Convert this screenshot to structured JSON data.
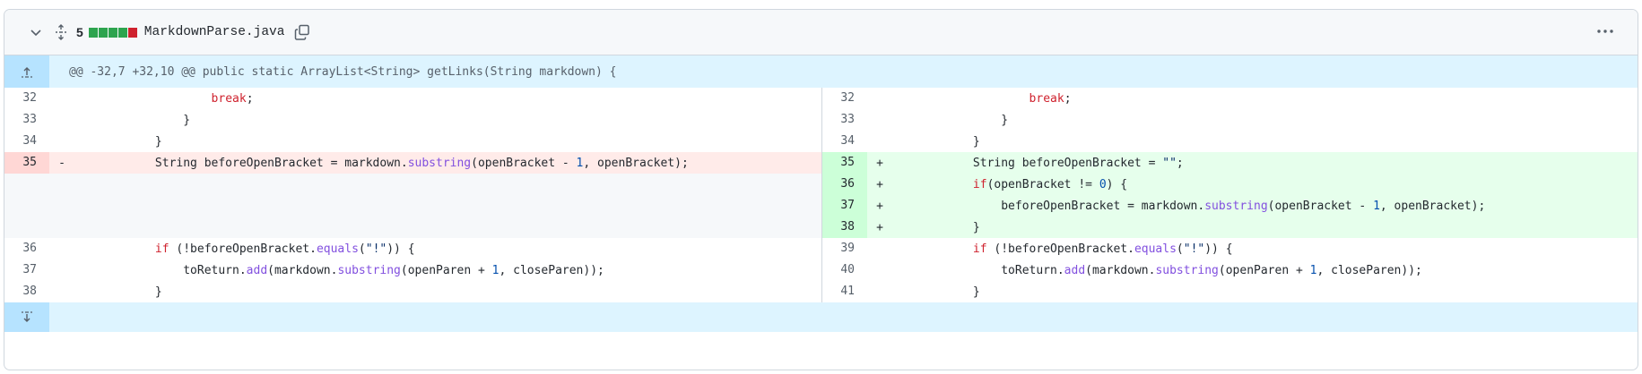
{
  "file_header": {
    "change_count": "5",
    "file_name": "MarkdownParse.java",
    "diffstat": [
      "#2da44e",
      "#2da44e",
      "#2da44e",
      "#2da44e",
      "#cf222e"
    ],
    "icons": {
      "collapse": "chevron-down-icon",
      "expand_all": "unfold-icon",
      "copy": "copy-icon",
      "more": "kebab-horizontal-icon"
    }
  },
  "hunk_header": {
    "text": "@@ -32,7 +32,10 @@ public static ArrayList<String> getLinks(String markdown) {",
    "expand_up_icon": "fold-up-icon"
  },
  "left_lines": [
    {
      "num": "32",
      "type": "context",
      "marker": "",
      "tokens": [
        [
          "",
          "                    "
        ],
        [
          "kw",
          "break"
        ],
        [
          "",
          ";"
        ]
      ]
    },
    {
      "num": "33",
      "type": "context",
      "marker": "",
      "tokens": [
        [
          "",
          "                }"
        ]
      ]
    },
    {
      "num": "34",
      "type": "context",
      "marker": "",
      "tokens": [
        [
          "",
          "            }"
        ]
      ]
    },
    {
      "num": "35",
      "type": "del",
      "marker": "-",
      "tokens": [
        [
          "",
          "            String beforeOpenBracket = markdown."
        ],
        [
          "fn",
          "substring"
        ],
        [
          "",
          "(openBracket - "
        ],
        [
          "num",
          "1"
        ],
        [
          "",
          ", openBracket);"
        ]
      ]
    },
    {
      "num": "",
      "type": "empty",
      "marker": "",
      "tokens": []
    },
    {
      "num": "",
      "type": "empty",
      "marker": "",
      "tokens": []
    },
    {
      "num": "",
      "type": "empty",
      "marker": "",
      "tokens": []
    },
    {
      "num": "36",
      "type": "context",
      "marker": "",
      "tokens": [
        [
          "",
          "            "
        ],
        [
          "kw",
          "if"
        ],
        [
          "",
          " (!beforeOpenBracket."
        ],
        [
          "fn",
          "equals"
        ],
        [
          "",
          "("
        ],
        [
          "str",
          "\"!\""
        ],
        [
          "",
          ")) {"
        ]
      ]
    },
    {
      "num": "37",
      "type": "context",
      "marker": "",
      "tokens": [
        [
          "",
          "                toReturn."
        ],
        [
          "fn",
          "add"
        ],
        [
          "",
          "(markdown."
        ],
        [
          "fn",
          "substring"
        ],
        [
          "",
          "(openParen + "
        ],
        [
          "num",
          "1"
        ],
        [
          "",
          ", closeParen));"
        ]
      ]
    },
    {
      "num": "38",
      "type": "context",
      "marker": "",
      "tokens": [
        [
          "",
          "            }"
        ]
      ]
    }
  ],
  "right_lines": [
    {
      "num": "32",
      "type": "context",
      "marker": "",
      "tokens": [
        [
          "",
          "                    "
        ],
        [
          "kw",
          "break"
        ],
        [
          "",
          ";"
        ]
      ]
    },
    {
      "num": "33",
      "type": "context",
      "marker": "",
      "tokens": [
        [
          "",
          "                }"
        ]
      ]
    },
    {
      "num": "34",
      "type": "context",
      "marker": "",
      "tokens": [
        [
          "",
          "            }"
        ]
      ]
    },
    {
      "num": "35",
      "type": "add",
      "marker": "+",
      "tokens": [
        [
          "",
          "            String beforeOpenBracket = "
        ],
        [
          "str",
          "\"\""
        ],
        [
          "",
          ";"
        ]
      ]
    },
    {
      "num": "36",
      "type": "add",
      "marker": "+",
      "tokens": [
        [
          "",
          "            "
        ],
        [
          "kw",
          "if"
        ],
        [
          "",
          "(openBracket != "
        ],
        [
          "num",
          "0"
        ],
        [
          "",
          ") {"
        ]
      ]
    },
    {
      "num": "37",
      "type": "add",
      "marker": "+",
      "tokens": [
        [
          "",
          "                beforeOpenBracket = markdown."
        ],
        [
          "fn",
          "substring"
        ],
        [
          "",
          "(openBracket - "
        ],
        [
          "num",
          "1"
        ],
        [
          "",
          ", openBracket);"
        ]
      ]
    },
    {
      "num": "38",
      "type": "add",
      "marker": "+",
      "tokens": [
        [
          "",
          "            }"
        ]
      ]
    },
    {
      "num": "39",
      "type": "context",
      "marker": "",
      "tokens": [
        [
          "",
          "            "
        ],
        [
          "kw",
          "if"
        ],
        [
          "",
          " (!beforeOpenBracket."
        ],
        [
          "fn",
          "equals"
        ],
        [
          "",
          "("
        ],
        [
          "str",
          "\"!\""
        ],
        [
          "",
          ")) {"
        ]
      ]
    },
    {
      "num": "40",
      "type": "context",
      "marker": "",
      "tokens": [
        [
          "",
          "                toReturn."
        ],
        [
          "fn",
          "add"
        ],
        [
          "",
          "(markdown."
        ],
        [
          "fn",
          "substring"
        ],
        [
          "",
          "(openParen + "
        ],
        [
          "num",
          "1"
        ],
        [
          "",
          ", closeParen));"
        ]
      ]
    },
    {
      "num": "41",
      "type": "context",
      "marker": "",
      "tokens": [
        [
          "",
          "            }"
        ]
      ]
    }
  ],
  "bottom_expander": {
    "icon": "fold-down-icon"
  }
}
